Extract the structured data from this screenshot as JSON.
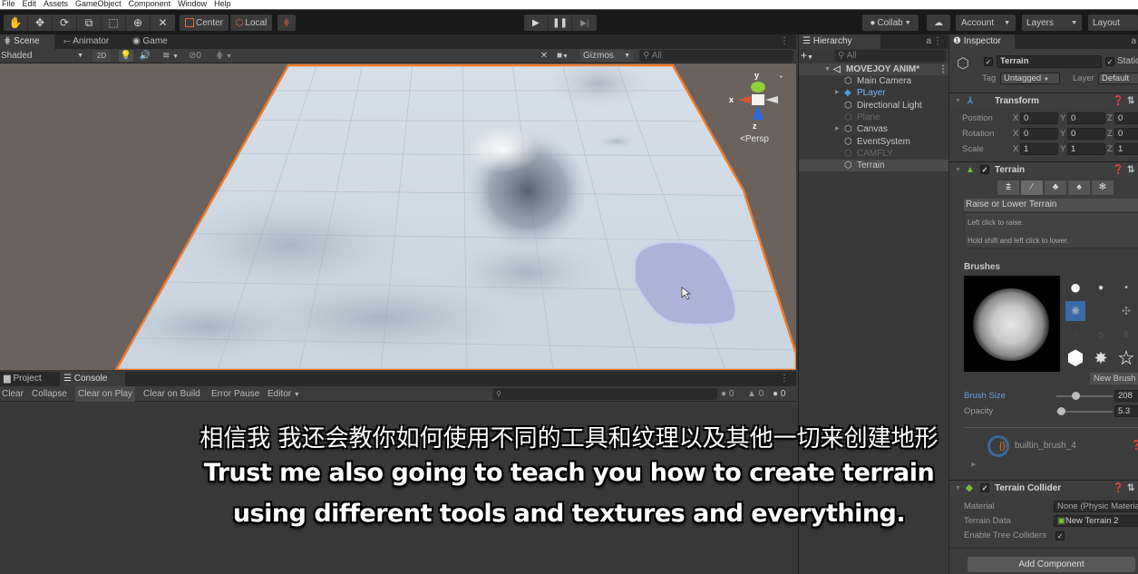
{
  "menu": [
    "File",
    "Edit",
    "Assets",
    "GameObject",
    "Component",
    "Window",
    "Help"
  ],
  "toolbar": {
    "tools": [
      "hand-icon",
      "move-icon",
      "rotate-icon",
      "scale-icon",
      "rect-icon",
      "transform-icon",
      "custom-tool-icon"
    ],
    "pivot_label": "Center",
    "space_label": "Local",
    "collab_label": "Collab",
    "account_label": "Account",
    "layers_label": "Layers",
    "layout_label": "Layout"
  },
  "scene": {
    "tabs": [
      "Scene",
      "Animator",
      "Game"
    ],
    "shading_mode": "Shaded",
    "mode_2d": "2D",
    "hidden_count": "0",
    "gizmos_label": "Gizmos",
    "search_placeholder": "All",
    "gizmo_axes": {
      "y": "y",
      "x": "x",
      "z": "z"
    },
    "projection_label": "Persp"
  },
  "console": {
    "tabs": [
      "Project",
      "Console"
    ],
    "buttons": [
      "Clear",
      "Collapse",
      "Clear on Play",
      "Clear on Build",
      "Error Pause",
      "Editor"
    ],
    "counts": {
      "info": "0",
      "warnings": "0",
      "errors": "0"
    }
  },
  "hierarchy": {
    "title": "Hierarchy",
    "search_placeholder": "All",
    "scene_name": "MOVEJOY ANIM*",
    "items": [
      {
        "label": "Main Camera",
        "state": "normal",
        "expandable": false
      },
      {
        "label": "PLayer",
        "state": "prefab",
        "expandable": true
      },
      {
        "label": "Directional Light",
        "state": "normal",
        "expandable": false
      },
      {
        "label": "Plane",
        "state": "disabled",
        "expandable": false
      },
      {
        "label": "Canvas",
        "state": "normal",
        "expandable": true
      },
      {
        "label": "EventSystem",
        "state": "normal",
        "expandable": false
      },
      {
        "label": "CAMFLY",
        "state": "disabled",
        "expandable": false
      },
      {
        "label": "Terrain",
        "state": "selected",
        "expandable": false
      }
    ]
  },
  "inspector": {
    "title": "Inspector",
    "object_name": "Terrain",
    "static_label": "Static",
    "tag_label": "Tag",
    "tag_value": "Untagged",
    "layer_label": "Layer",
    "layer_value": "Default",
    "transform": {
      "title": "Transform",
      "rows": [
        {
          "label": "Position",
          "x": "0",
          "y": "0",
          "z": "0"
        },
        {
          "label": "Rotation",
          "x": "0",
          "y": "0",
          "z": "0"
        },
        {
          "label": "Scale",
          "x": "1",
          "y": "1",
          "z": "1"
        }
      ]
    },
    "terrain": {
      "title": "Terrain",
      "tool_name": "Raise or Lower Terrain",
      "help_line1": "Left click to raise.",
      "help_line2": "Hold shift and left click to lower.",
      "brushes_label": "Brushes",
      "new_brush_label": "New Brush",
      "brush_size_label": "Brush Size",
      "brush_size_value": "208",
      "brush_size_fraction": 0.08,
      "opacity_label": "Opacity",
      "opacity_value": "5.3",
      "opacity_fraction": 0.053,
      "brush_asset": "builtin_brush_4"
    },
    "collider": {
      "title": "Terrain Collider",
      "material_label": "Material",
      "material_value": "None (Physic Material)",
      "data_label": "Terrain Data",
      "data_value": "New Terrain 2",
      "trees_label": "Enable Tree Colliders",
      "trees_checked": true
    },
    "add_component_label": "Add Component"
  },
  "subtitles": {
    "zh": "相信我 我还会教你如何使用不同的工具和纹理以及其他一切来创建地形",
    "en_line1": "Trust me also going to teach you how to create terrain",
    "en_line2": "using different tools and textures and everything."
  },
  "colors": {
    "selection_outline": "#f07a2a",
    "accent_blue": "#3a72c4",
    "prefab_blue": "#7cb5f0"
  }
}
